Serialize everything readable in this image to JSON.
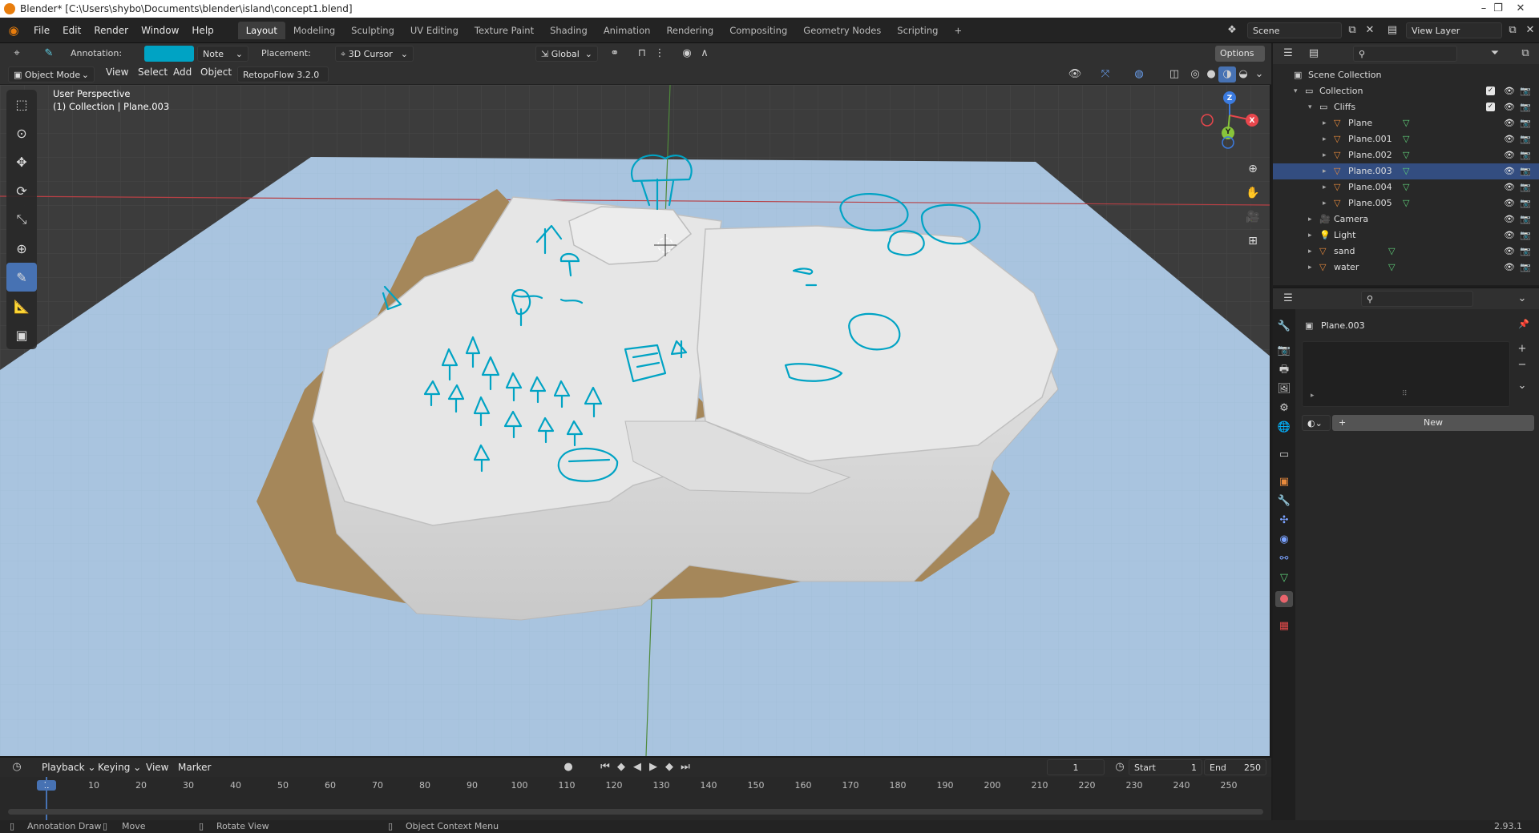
{
  "titlebar": {
    "title": "Blender* [C:\\Users\\shybo\\Documents\\blender\\island\\concept1.blend]",
    "controls": [
      "–",
      "❐",
      "✕"
    ]
  },
  "menubar": {
    "menus": [
      "File",
      "Edit",
      "Render",
      "Window",
      "Help"
    ],
    "workspaces": [
      "Layout",
      "Modeling",
      "Sculpting",
      "UV Editing",
      "Texture Paint",
      "Shading",
      "Animation",
      "Rendering",
      "Compositing",
      "Geometry Nodes",
      "Scripting"
    ],
    "active_workspace": "Layout",
    "add_tab": "+",
    "scene": "Scene",
    "view_layer": "View Layer"
  },
  "tool_header": {
    "annotation_label": "Annotation:",
    "annotation_color": "#00a3c4",
    "note_value": "Note",
    "placement_label": "Placement:",
    "placement_value": "3D Cursor",
    "orientation_value": "Global",
    "options_label": "Options"
  },
  "view_header": {
    "mode": "Object Mode",
    "menus": [
      "View",
      "Select",
      "Add",
      "Object"
    ],
    "addon": "RetopoFlow 3.2.0"
  },
  "viewport": {
    "perspective": "User Perspective",
    "collection_info": "(1) Collection | Plane.003",
    "gizmo_axes": [
      "Z",
      "Y",
      "X"
    ],
    "colors": {
      "x_axis": "#e8464c",
      "y_axis": "#88c43a",
      "z_axis": "#3b7be0",
      "ground": "#a9c4df",
      "cliff": "#dcdcdc",
      "sand": "#a5875a",
      "annotation": "#00a3c4"
    }
  },
  "outliner": {
    "root": "Scene Collection",
    "items": [
      {
        "label": "Collection",
        "depth": 1,
        "type": "collection",
        "checked": true
      },
      {
        "label": "Cliffs",
        "depth": 2,
        "type": "collection",
        "checked": true
      },
      {
        "label": "Plane",
        "depth": 3,
        "type": "mesh"
      },
      {
        "label": "Plane.001",
        "depth": 3,
        "type": "mesh"
      },
      {
        "label": "Plane.002",
        "depth": 3,
        "type": "mesh"
      },
      {
        "label": "Plane.003",
        "depth": 3,
        "type": "mesh",
        "selected": true
      },
      {
        "label": "Plane.004",
        "depth": 3,
        "type": "mesh"
      },
      {
        "label": "Plane.005",
        "depth": 3,
        "type": "mesh"
      },
      {
        "label": "Camera",
        "depth": 2,
        "type": "camera"
      },
      {
        "label": "Light",
        "depth": 2,
        "type": "light"
      },
      {
        "label": "sand",
        "depth": 2,
        "type": "mesh"
      },
      {
        "label": "water",
        "depth": 2,
        "type": "mesh"
      }
    ]
  },
  "properties": {
    "object_name": "Plane.003",
    "new_button": "New"
  },
  "timeline": {
    "menus": [
      "Playback",
      "Keying",
      "View",
      "Marker"
    ],
    "current_frame": "1",
    "start_label": "Start",
    "start_value": "1",
    "end_label": "End",
    "end_value": "250",
    "frame_ticks": [
      "1",
      "10",
      "20",
      "30",
      "40",
      "50",
      "60",
      "70",
      "80",
      "90",
      "100",
      "110",
      "120",
      "130",
      "140",
      "150",
      "160",
      "170",
      "180",
      "190",
      "200",
      "210",
      "220",
      "230",
      "240",
      "250"
    ]
  },
  "statusbar": {
    "hints": [
      "Annotation Draw",
      "Move",
      "Rotate View",
      "Object Context Menu"
    ],
    "version": "2.93.1"
  }
}
